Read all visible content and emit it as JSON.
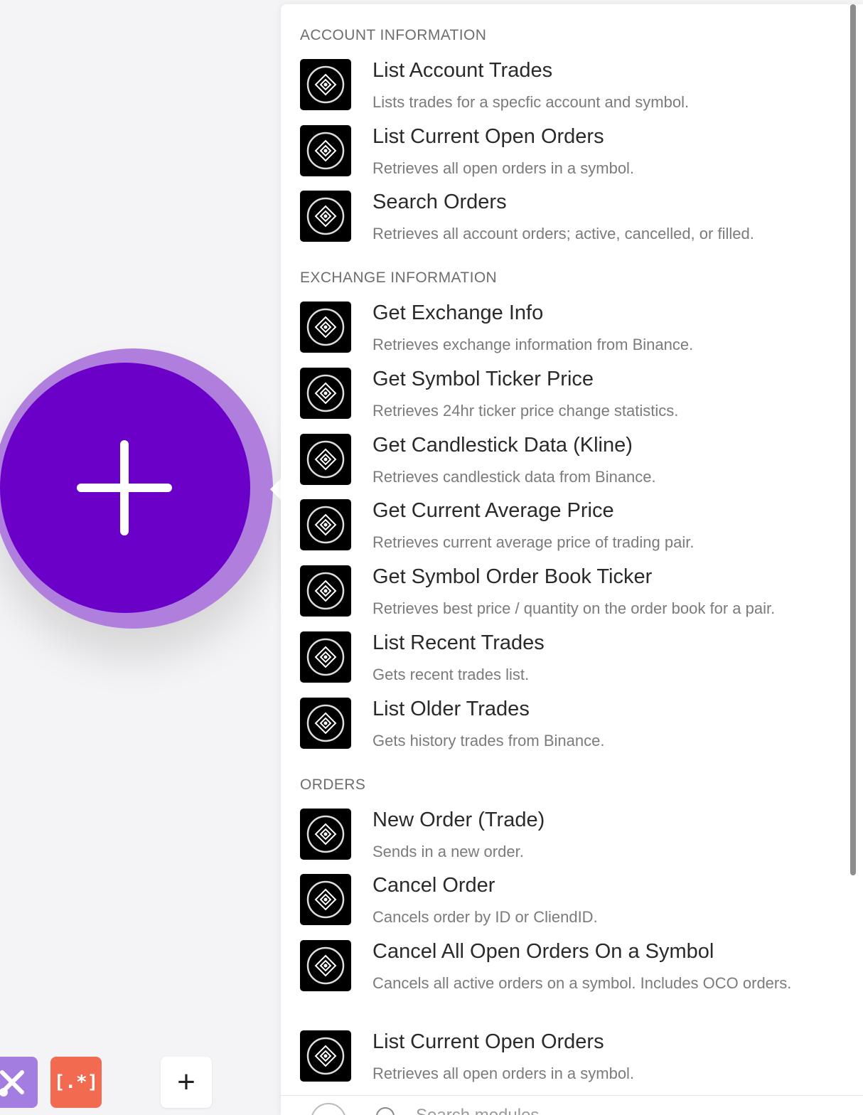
{
  "canvas": {
    "add_module_label": "+",
    "toolbar_add_label": "+",
    "regex_label": "[.*]"
  },
  "panel": {
    "sections": [
      {
        "title": "ACCOUNT INFORMATION",
        "items": [
          {
            "title": "List Account Trades",
            "desc": "Lists trades for a specfic account and symbol."
          },
          {
            "title": "List Current Open Orders",
            "desc": "Retrieves all open orders in a symbol."
          },
          {
            "title": "Search Orders",
            "desc": "Retrieves all account orders; active, cancelled, or filled."
          }
        ]
      },
      {
        "title": "EXCHANGE INFORMATION",
        "items": [
          {
            "title": "Get Exchange Info",
            "desc": "Retrieves exchange information from Binance."
          },
          {
            "title": "Get Symbol Ticker Price",
            "desc": "Retrieves 24hr ticker price change statistics."
          },
          {
            "title": "Get Candlestick Data (Kline)",
            "desc": "Retrieves candlestick data from Binance."
          },
          {
            "title": "Get Current Average Price",
            "desc": "Retrieves current average price of trading pair."
          },
          {
            "title": "Get Symbol Order Book Ticker",
            "desc": "Retrieves best price / quantity on the order book for a pair."
          },
          {
            "title": "List Recent Trades",
            "desc": "Gets recent trades list."
          },
          {
            "title": "List Older Trades",
            "desc": "Gets history trades from Binance."
          }
        ]
      },
      {
        "title": "ORDERS",
        "items": [
          {
            "title": "New Order (Trade)",
            "desc": "Sends in a new order."
          },
          {
            "title": "Cancel Order",
            "desc": "Cancels order by ID or CliendID."
          },
          {
            "title": "Cancel All Open Orders On a Symbol",
            "desc": "Cancels all active orders on a symbol. Includes OCO orders."
          },
          {
            "title": "List Current Open Orders",
            "desc": "Retrieves all open orders in a symbol."
          }
        ]
      }
    ],
    "search_placeholder": "Search modules"
  }
}
